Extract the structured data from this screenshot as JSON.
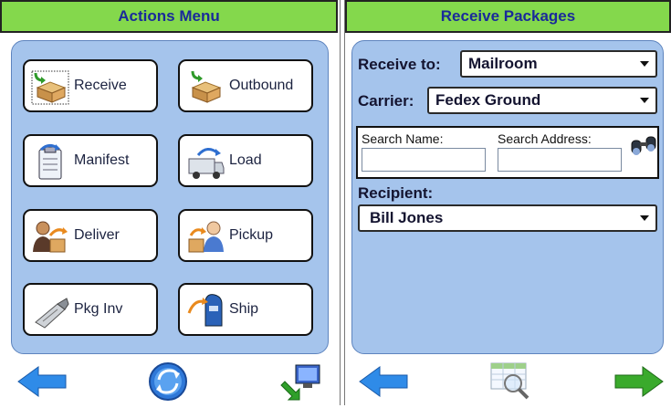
{
  "actions_menu": {
    "title": "Actions Menu",
    "buttons": [
      {
        "label": "Receive",
        "icon": "receive-box-icon"
      },
      {
        "label": "Outbound",
        "icon": "outbound-box-icon"
      },
      {
        "label": "Manifest",
        "icon": "manifest-clipboard-icon"
      },
      {
        "label": "Load",
        "icon": "load-truck-icon"
      },
      {
        "label": "Deliver",
        "icon": "deliver-person-icon"
      },
      {
        "label": "Pickup",
        "icon": "pickup-person-icon"
      },
      {
        "label": "Pkg Inv",
        "icon": "barcode-scanner-icon"
      },
      {
        "label": "Ship",
        "icon": "ship-mailbox-icon"
      }
    ],
    "bottom": {
      "back_icon": "back-arrow-icon",
      "refresh_icon": "refresh-icon",
      "network_icon": "network-computer-icon"
    }
  },
  "receive_packages": {
    "title": "Receive Packages",
    "receive_to": {
      "label": "Receive to:",
      "value": "Mailroom"
    },
    "carrier": {
      "label": "Carrier:",
      "value": "Fedex Ground"
    },
    "search": {
      "name_label": "Search Name:",
      "address_label": "Search Address:",
      "name_value": "",
      "address_value": ""
    },
    "recipient": {
      "label": "Recipient:",
      "value": "Bill Jones"
    },
    "bottom": {
      "back_icon": "back-arrow-icon",
      "grid_search_icon": "grid-search-icon",
      "next_icon": "next-arrow-icon"
    }
  },
  "colors": {
    "header_bg": "#84d84c",
    "header_text": "#1a2a9a",
    "content_bg": "#a5c4ec"
  }
}
